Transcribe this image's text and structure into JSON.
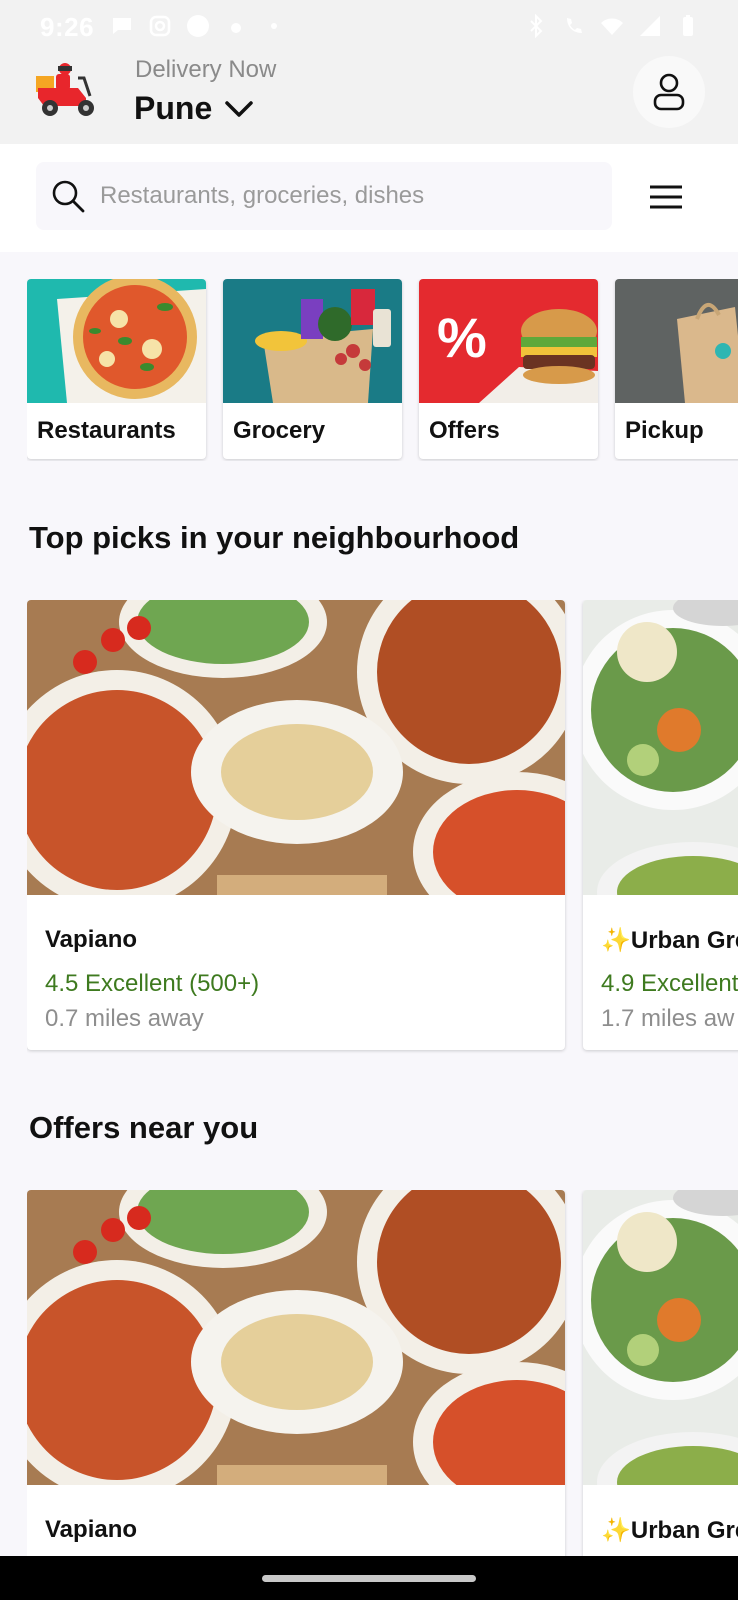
{
  "status_bar": {
    "time": "9:26"
  },
  "header": {
    "delivery_label": "Delivery Now",
    "city": "Pune"
  },
  "search": {
    "placeholder": "Restaurants, groceries, dishes"
  },
  "categories": [
    {
      "label": "Restaurants"
    },
    {
      "label": "Grocery"
    },
    {
      "label": "Offers"
    },
    {
      "label": "Pickup"
    }
  ],
  "sections": [
    {
      "title": "Top picks in your neighbourhood",
      "restaurants": [
        {
          "name": "Vapiano",
          "rating": "4.5 Excellent (500+)",
          "distance": "0.7 miles away"
        },
        {
          "name": "✨Urban Gre",
          "rating": "4.9 Excellent",
          "distance": "1.7 miles aw"
        }
      ]
    },
    {
      "title": "Offers near you",
      "restaurants": [
        {
          "name": "Vapiano"
        },
        {
          "name": "✨Urban Gre"
        }
      ]
    }
  ],
  "colors": {
    "rating_green": "#3e7a1f",
    "accent_red": "#e8262c"
  }
}
